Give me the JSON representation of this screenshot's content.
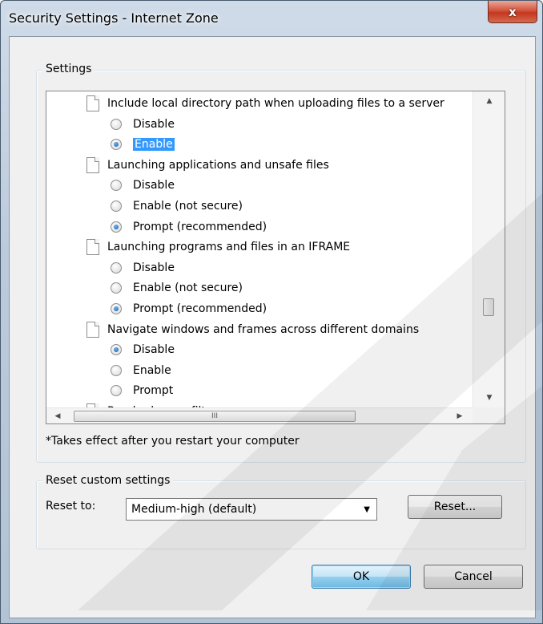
{
  "window": {
    "title": "Security Settings - Internet Zone",
    "close_label": "x"
  },
  "settings_group": {
    "label": "Settings",
    "rows": [
      {
        "type": "item",
        "label": "Include local directory path when uploading files to a server"
      },
      {
        "type": "option",
        "label": "Disable",
        "checked": false,
        "selected": false
      },
      {
        "type": "option",
        "label": "Enable",
        "checked": true,
        "selected": true
      },
      {
        "type": "item",
        "label": "Launching applications and unsafe files"
      },
      {
        "type": "option",
        "label": "Disable",
        "checked": false,
        "selected": false
      },
      {
        "type": "option",
        "label": "Enable (not secure)",
        "checked": false,
        "selected": false
      },
      {
        "type": "option",
        "label": "Prompt (recommended)",
        "checked": true,
        "selected": false
      },
      {
        "type": "item",
        "label": "Launching programs and files in an IFRAME"
      },
      {
        "type": "option",
        "label": "Disable",
        "checked": false,
        "selected": false
      },
      {
        "type": "option",
        "label": "Enable (not secure)",
        "checked": false,
        "selected": false
      },
      {
        "type": "option",
        "label": "Prompt (recommended)",
        "checked": true,
        "selected": false
      },
      {
        "type": "item",
        "label": "Navigate windows and frames across different domains"
      },
      {
        "type": "option",
        "label": "Disable",
        "checked": true,
        "selected": false
      },
      {
        "type": "option",
        "label": "Enable",
        "checked": false,
        "selected": false
      },
      {
        "type": "option",
        "label": "Prompt",
        "checked": false,
        "selected": false
      },
      {
        "type": "item",
        "label": "Render legacy filters"
      }
    ],
    "note": "*Takes effect after you restart your computer"
  },
  "reset_group": {
    "label": "Reset custom settings",
    "reset_to_label": "Reset to:",
    "selected_level": "Medium-high (default)",
    "reset_button": "Reset..."
  },
  "buttons": {
    "ok": "OK",
    "cancel": "Cancel"
  },
  "scrollbar": {
    "up_arrow": "▲",
    "down_arrow": "▼",
    "left_arrow": "◀",
    "right_arrow": "▶",
    "grip": "III"
  },
  "colors": {
    "selection": "#3399ff",
    "close_button": "#c3371f"
  }
}
